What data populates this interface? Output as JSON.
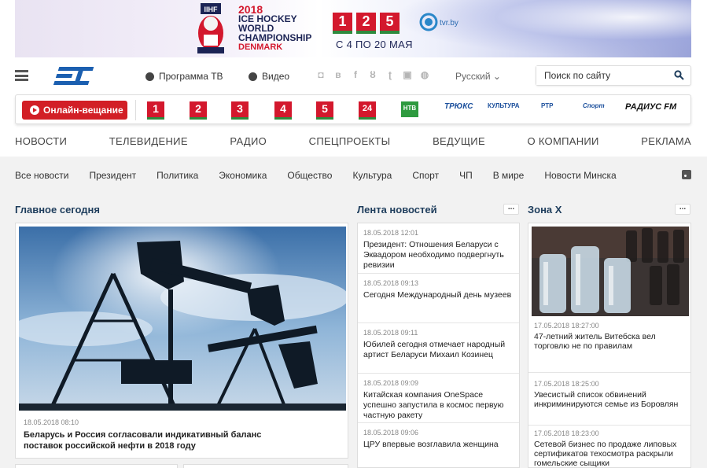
{
  "banner": {
    "year": "2018",
    "line1": "ICE HOCKEY",
    "line2": "WORLD",
    "line3": "CHAMPIONSHIP",
    "country": "DENMARK",
    "channels": [
      "1",
      "2",
      "5"
    ],
    "tvr": "tvr.by",
    "dates": "С 4 ПО 20 МАЯ"
  },
  "header": {
    "logo": "ВТ",
    "program_tv": "Программа ТВ",
    "video": "Видео",
    "social": [
      "instagram-icon",
      "vk-icon",
      "facebook-icon",
      "odnoklassniki-icon",
      "twitter-icon",
      "youtube-icon",
      "android-icon"
    ],
    "language": "Русский",
    "search_placeholder": "Поиск по сайту"
  },
  "channels_strip": {
    "live_button": "Онлайн-вещание",
    "channels": [
      "1",
      "2",
      "3",
      "4",
      "5",
      "24"
    ],
    "text_channels": [
      "НТВ",
      "ТРЮКС",
      "КУЛЬТУРА",
      "РТР",
      "Спорт",
      "РАДИУС FM"
    ]
  },
  "main_menu": [
    "НОВОСТИ",
    "ТЕЛЕВИДЕНИЕ",
    "РАДИО",
    "СПЕЦПРОЕКТЫ",
    "ВЕДУЩИЕ",
    "О КОМПАНИИ",
    "РЕКЛАМА"
  ],
  "sub_menu": [
    "Все новости",
    "Президент",
    "Политика",
    "Экономика",
    "Общество",
    "Культура",
    "Спорт",
    "ЧП",
    "В мире",
    "Новости Минска"
  ],
  "sections": {
    "main_today": "Главное сегодня",
    "news_feed": "Лента новостей",
    "zone_x": "Зона Х"
  },
  "main_story": {
    "date": "18.05.2018 08:10",
    "title": "Беларусь и Россия согласовали индикативный баланс поставок российской нефти в 2018 году"
  },
  "feed": [
    {
      "date": "18.05.2018 12:01",
      "title": "Президент: Отношения Беларуси с Эквадором необходимо подвергнуть ревизии"
    },
    {
      "date": "18.05.2018 09:13",
      "title": "Сегодня Международный день музеев"
    },
    {
      "date": "18.05.2018 09:11",
      "title": "Юбилей сегодня отмечает народный артист Беларуси Михаил Козинец"
    },
    {
      "date": "18.05.2018 09:09",
      "title": "Китайская компания OneSpace успешно запустила в космос первую частную ракету"
    },
    {
      "date": "18.05.2018 09:06",
      "title": "ЦРУ впервые возглавила женщина"
    }
  ],
  "zone_x": [
    {
      "date": "17.05.2018 18:27:00",
      "title": "47-летний житель Витебска вел торговлю не по правилам"
    },
    {
      "date": "17.05.2018 18:25:00",
      "title": "Увесистый список обвинений инкриминируются семье из Боровлян"
    },
    {
      "date": "17.05.2018 18:23:00",
      "title": "Сетевой бизнес по продаже липовых сертификатов техосмотра раскрыли гомельские сыщики"
    }
  ],
  "colors": {
    "accent": "#d21f26",
    "logo_blue": "#1b5fb0",
    "section_title": "#1e3d5c"
  }
}
